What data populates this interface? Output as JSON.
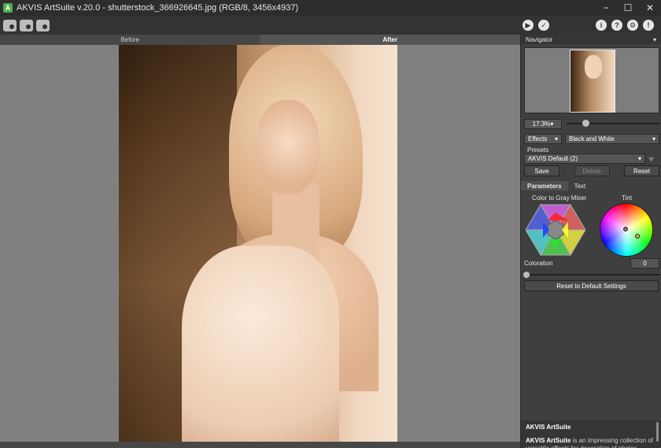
{
  "app": {
    "title": "AKVIS ArtSuite v.20.0 - shutterstock_366926645.jpg (RGB/8, 3456x4937)"
  },
  "window_controls": {
    "minimize": "−",
    "maximize": "☐",
    "close": "✕"
  },
  "toolbar": {
    "icons": [
      "open-image-icon",
      "save-image-icon",
      "print-image-icon"
    ],
    "right_icons": [
      "run-icon",
      "apply-icon",
      "info-icon",
      "help-icon",
      "settings-icon",
      "notifications-icon"
    ],
    "run": "▶",
    "apply": "✓",
    "info": "i",
    "help": "?",
    "settings": "⚙",
    "notifications": "!"
  },
  "view_tabs": {
    "before": "Before",
    "after": "After",
    "active": "After"
  },
  "navigator": {
    "header": "Navigator",
    "collapse_glyph": "▾"
  },
  "zoom": {
    "value": "17.3%",
    "slider_level": 0.17
  },
  "effects": {
    "label": "Effects",
    "selected": "Black and White"
  },
  "presets": {
    "label": "Presets",
    "selected": "AKVIS Default (2)",
    "save": "Save",
    "delete": "Delete",
    "reset": "Reset"
  },
  "param_tabs": {
    "parameters": "Parameters",
    "text": "Text"
  },
  "mixer": {
    "label": "Color to Gray Mixer"
  },
  "tint": {
    "label": "Tint"
  },
  "coloration": {
    "label": "Coloration",
    "value": "0"
  },
  "reset_defaults": "Reset to Default Settings",
  "help": {
    "title": "AKVIS ArtSuite",
    "brand": "AKVIS ArtSuite",
    "body": " is an impressing collection of versatile effects for decoration of photos."
  }
}
